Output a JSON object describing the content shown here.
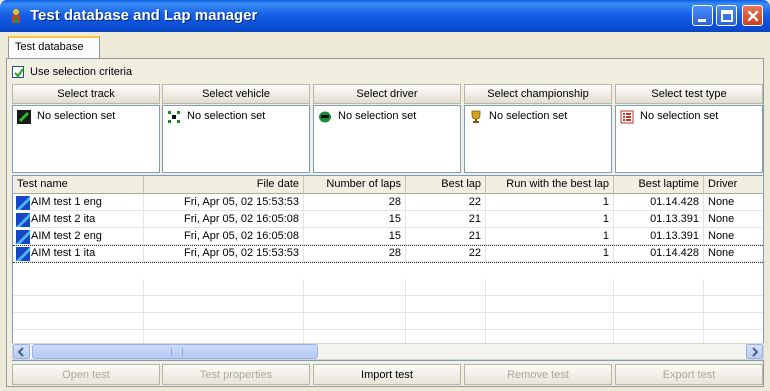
{
  "window": {
    "title": "Test database and Lap manager"
  },
  "tabs": [
    {
      "label": "Test database"
    }
  ],
  "criteria": {
    "label": "Use selection criteria",
    "checked": true
  },
  "selectors": [
    {
      "header": "Select track",
      "value": "No selection set",
      "icon": "track-flag-icon"
    },
    {
      "header": "Select vehicle",
      "value": "No selection set",
      "icon": "vehicle-icon"
    },
    {
      "header": "Select driver",
      "value": "No selection set",
      "icon": "driver-helmet-icon"
    },
    {
      "header": "Select championship",
      "value": "No selection set",
      "icon": "trophy-icon"
    },
    {
      "header": "Select test type",
      "value": "No selection set",
      "icon": "list-icon"
    }
  ],
  "table": {
    "columns": [
      "Test name",
      "File date",
      "Number of laps",
      "Best lap",
      "Run with the best lap",
      "Best laptime",
      "Driver"
    ],
    "rows": [
      [
        "AIM test 1 eng",
        "Fri, Apr 05, 02  15:53:53",
        "28",
        "22",
        "1",
        "01.14.428",
        "None"
      ],
      [
        "AIM test 2 ita",
        "Fri, Apr 05, 02  16:05:08",
        "15",
        "21",
        "1",
        "01.13.391",
        "None"
      ],
      [
        "AIM test 2 eng",
        "Fri, Apr 05, 02  16:05:08",
        "15",
        "21",
        "1",
        "01.13.391",
        "None"
      ],
      [
        "AIM test 1 ita",
        "Fri, Apr 05, 02  15:53:53",
        "28",
        "22",
        "1",
        "01.14.428",
        "None"
      ]
    ]
  },
  "buttons": {
    "open_test": "Open test",
    "test_properties": "Test properties",
    "import_test": "Import test",
    "remove_test": "Remove test",
    "export_test": "Export test"
  }
}
